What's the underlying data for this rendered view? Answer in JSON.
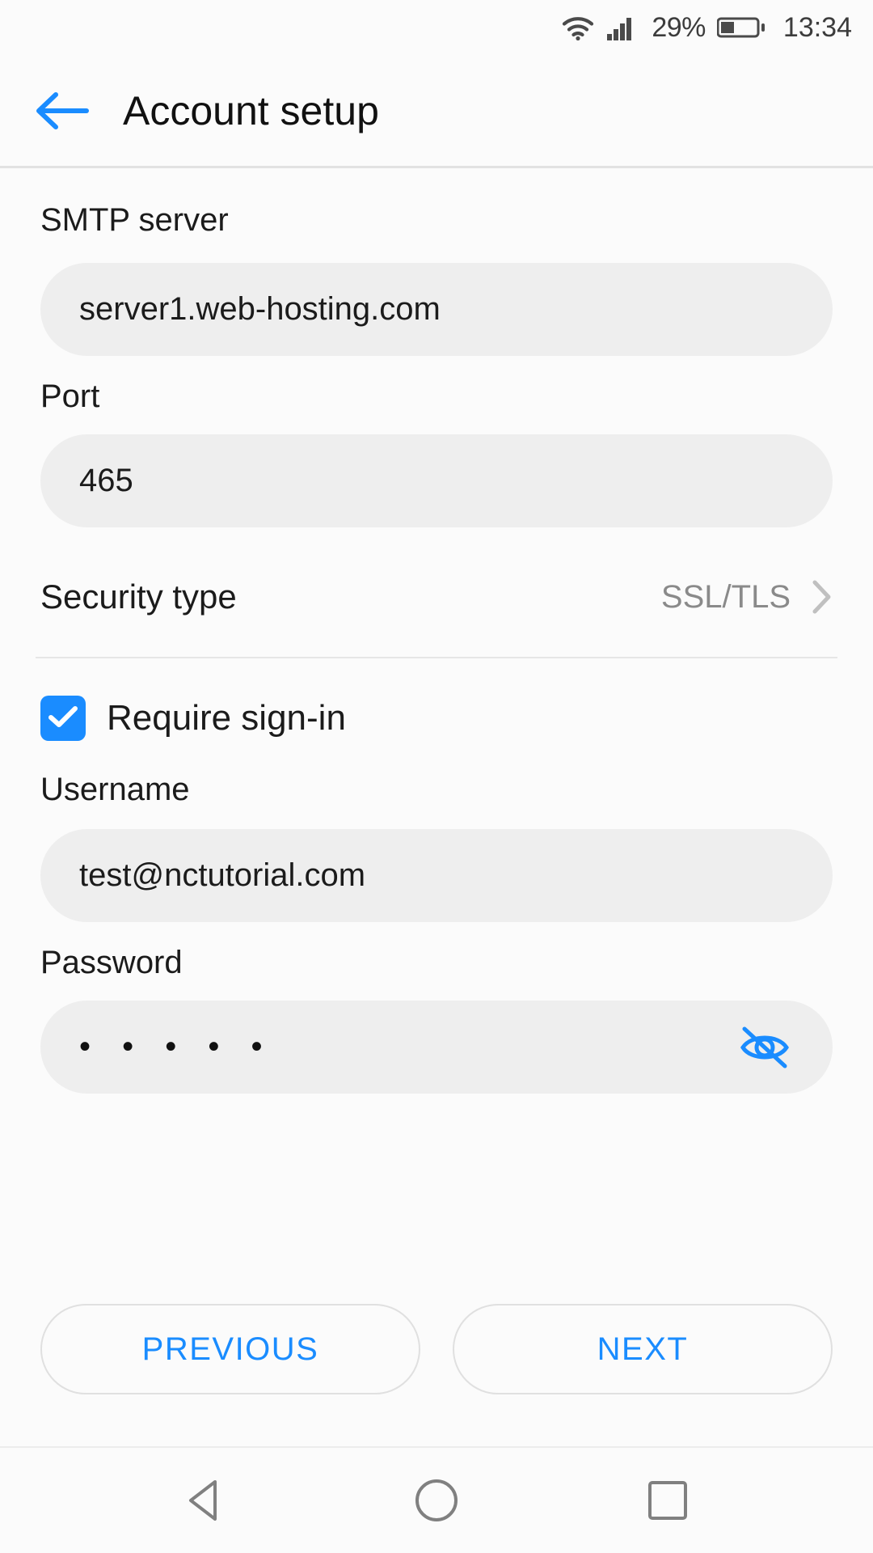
{
  "status_bar": {
    "wifi_icon": "wifi-icon",
    "signal_icon": "cellular-signal-icon",
    "battery_percent": "29%",
    "battery_icon": "battery-icon",
    "time": "13:34"
  },
  "title_bar": {
    "back_icon": "back-arrow-icon",
    "title": "Account setup"
  },
  "form": {
    "smtp_server": {
      "label": "SMTP server",
      "value": "server1.web-hosting.com",
      "placeholder": "SMTP server"
    },
    "port": {
      "label": "Port",
      "value": "465",
      "placeholder": "Port"
    },
    "security_type": {
      "label": "Security type",
      "value": "SSL/TLS",
      "chevron_icon": "chevron-right-icon"
    },
    "require_signin": {
      "label": "Require sign-in",
      "checked": true,
      "check_icon": "checkmark-icon"
    },
    "username": {
      "label": "Username",
      "value": "test@nctutorial.com",
      "placeholder": "Username"
    },
    "password": {
      "label": "Password",
      "value": "• • • • •",
      "placeholder": "Password",
      "toggle_icon": "eye-off-icon"
    }
  },
  "actions": {
    "previous_label": "PREVIOUS",
    "next_label": "NEXT"
  },
  "nav_bar": {
    "back_icon": "nav-back-triangle-icon",
    "home_icon": "nav-home-circle-icon",
    "recents_icon": "nav-recents-square-icon"
  },
  "colors": {
    "accent": "#1a8cff",
    "field_bg": "#eeeeee",
    "page_bg": "#fbfbfb",
    "muted_text": "#8a8a8a"
  }
}
